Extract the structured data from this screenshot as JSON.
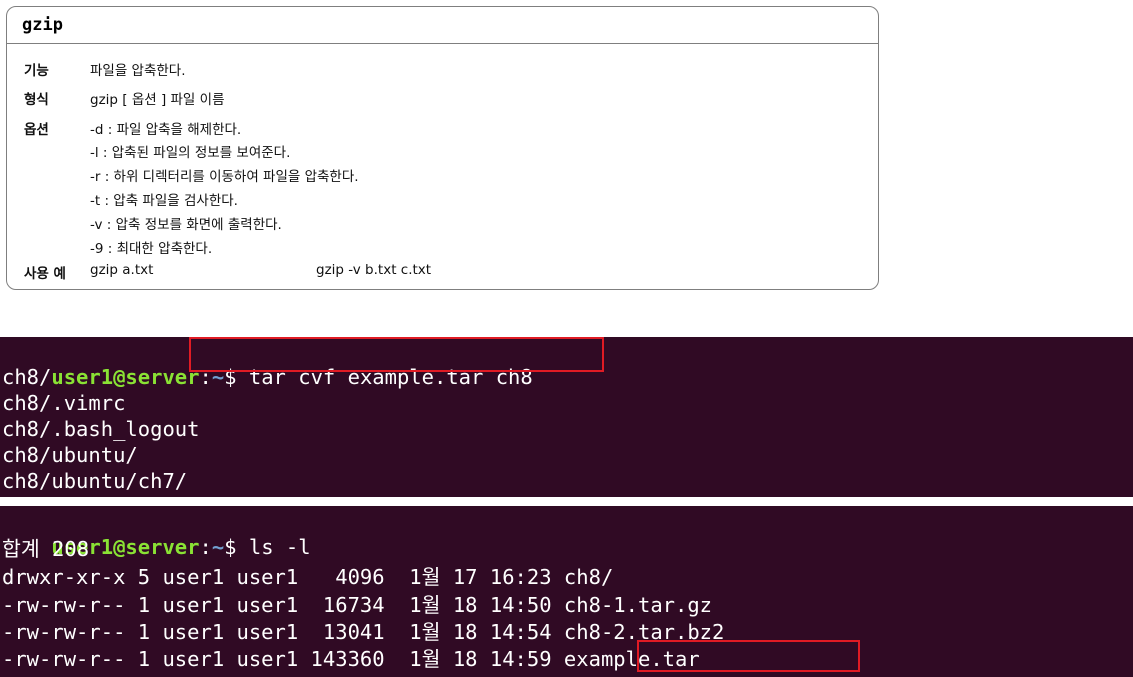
{
  "card": {
    "title": "gzip",
    "labels": {
      "func": "기능",
      "form": "형식",
      "opts": "옵션",
      "example": "사용 예"
    },
    "func_text": "파일을 압축한다.",
    "form_text": "gzip [ 옵션 ] 파일 이름",
    "options": [
      "-d : 파일 압축을 해제한다.",
      "-l : 압축된 파일의 정보를 보여준다.",
      "-r : 하위 디렉터리를 이동하여 파일을 압축한다.",
      "-t : 압축 파일을 검사한다.",
      "-v : 압축 정보를 화면에 출력한다.",
      "-9 : 최대한 압축한다."
    ],
    "example1": "gzip a.txt",
    "example2": "gzip -v b.txt c.txt"
  },
  "terminal1": {
    "prompt_user": "user1@server",
    "prompt_sep": ":",
    "prompt_path": "~",
    "prompt_end": "$ ",
    "command": "tar cvf example.tar ch8",
    "output": [
      "ch8/",
      "ch8/.vimrc",
      "ch8/.bash_logout",
      "ch8/ubuntu/",
      "ch8/ubuntu/ch7/"
    ]
  },
  "terminal2": {
    "prompt_user": "user1@server",
    "prompt_sep": ":",
    "prompt_path": "~",
    "prompt_end": "$ ",
    "command": "ls -l",
    "total": "합계 208",
    "rows": [
      {
        "prefix": "drwxr-xr-x 5 user1 user1   4096  1월 17 16:23 ",
        "name": "ch8/"
      },
      {
        "prefix": "-rw-rw-r-- 1 user1 user1  16734  1월 18 14:50 ",
        "name": "ch8-1.tar.gz"
      },
      {
        "prefix": "-rw-rw-r-- 1 user1 user1  13041  1월 18 14:54 ",
        "name": "ch8-2.tar.bz2"
      },
      {
        "prefix": "-rw-rw-r-- 1 user1 user1 143360  1월 18 14:59 ",
        "name": "example.tar"
      }
    ]
  },
  "colors": {
    "terminal_bg": "#300a24",
    "prompt": "#8ae234",
    "highlight": "#e01b24"
  }
}
